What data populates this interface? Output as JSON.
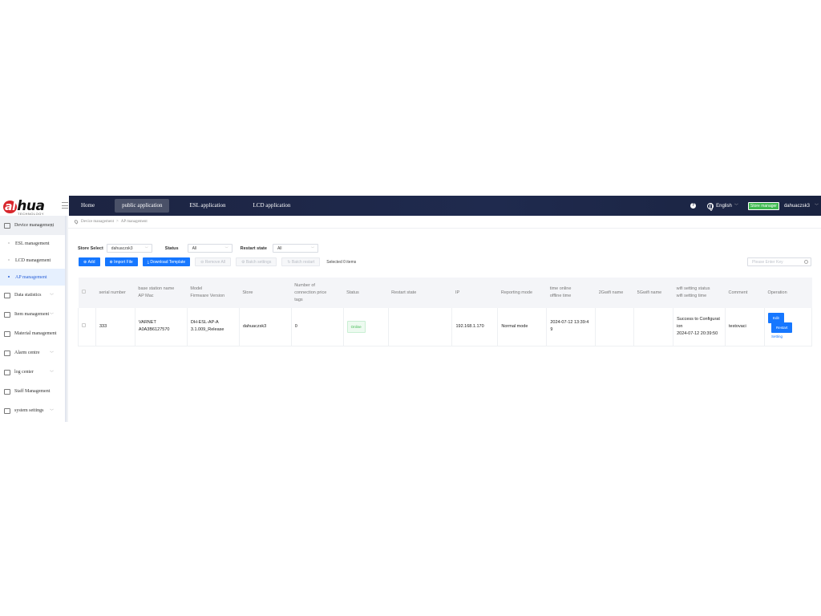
{
  "topbar": {
    "logo_text_1": "al",
    "logo_text_2": "hua",
    "logo_sub": "TECHNOLOGY",
    "nav": [
      "Home",
      "public application",
      "ESL application",
      "LCD application"
    ],
    "language": "English",
    "role": "Store manager",
    "username": "dahuaczsk3"
  },
  "sidebar": {
    "items": [
      {
        "label": "Device management",
        "icon": "device-icon"
      },
      {
        "label": "ESL management"
      },
      {
        "label": "LCD management"
      },
      {
        "label": "AP management"
      },
      {
        "label": "Data statistics",
        "icon": "chart-icon"
      },
      {
        "label": "Item management",
        "icon": "cart-icon"
      },
      {
        "label": "Material management",
        "icon": "folder-icon"
      },
      {
        "label": "Alarm centre",
        "icon": "alarm-icon"
      },
      {
        "label": "log center",
        "icon": "log-icon"
      },
      {
        "label": "Staff Management",
        "icon": "user-icon"
      },
      {
        "label": "system settings",
        "icon": "gear-icon"
      }
    ]
  },
  "breadcrumb": [
    "Device management",
    ">",
    "AP management"
  ],
  "filters": {
    "store_label": "Store Select",
    "store_value": "dahuaczsk3",
    "status_label": "Status",
    "status_value": "All",
    "restart_label": "Restart state",
    "restart_value": "All"
  },
  "actions": {
    "add": "Add",
    "import": "Import File",
    "download": "Download Template",
    "remove": "Remove All",
    "batch_settings": "Batch settings",
    "batch_restart": "Batch restart",
    "selected": "Selected 0 items",
    "search_placeholder": "Please Enter Key"
  },
  "table": {
    "headers": {
      "serial": "serial number",
      "bs_name": "base station name",
      "ap_mac": "AP Mac",
      "model": "Model",
      "firmware": "Firmware Version",
      "store": "Store",
      "num_tags_1": "Number of",
      "num_tags_2": "connection price",
      "num_tags_3": "tags",
      "status": "Status",
      "restart": "Restart state",
      "ip": "IP",
      "reporting": "Reporting mode",
      "time_online": "time online",
      "offline_time": "offline time",
      "wifi2g": "2Gwifi name",
      "wifi5g": "5Gwifi name",
      "wifi_status": "wifi setting status",
      "wifi_time": "wifi setting time",
      "comment": "Comment",
      "operation": "Operation"
    },
    "row": {
      "serial": "333",
      "bs_name": "VARNET",
      "ap_mac": "A0A3B6127570",
      "model_1": "DH-ESL-AP-A",
      "model_2": "3.1.009_Release",
      "store": "dahuaczsk3",
      "num_tags": "0",
      "status": "Online",
      "ip": "192.168.1.170",
      "reporting": "Normal mode",
      "time_1": "2024-07-12 13:39:4",
      "time_2": "9",
      "wifi_status_1": "Success to Configurat",
      "wifi_status_2": "ion",
      "wifi_time": "2024-07-12 20:39:50",
      "comment": "testovaci",
      "op_edit": "Edit",
      "op_restart": "Restart",
      "op_setting": "Setting"
    }
  }
}
